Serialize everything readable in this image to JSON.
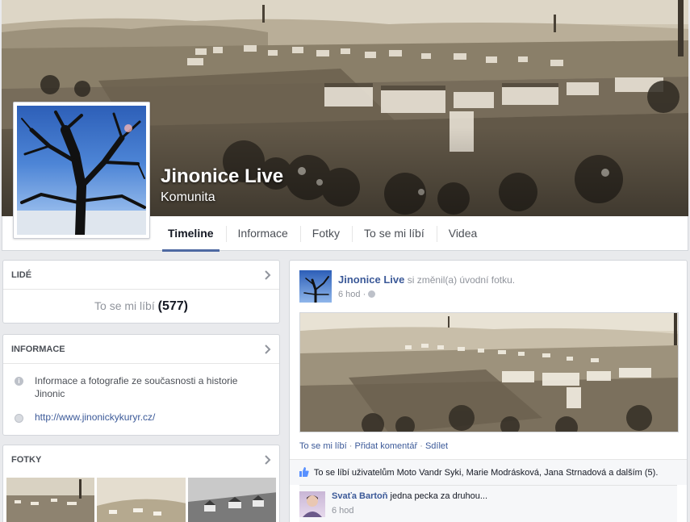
{
  "page": {
    "name": "Jinonice Live",
    "category": "Komunita"
  },
  "tabs": [
    {
      "label": "Timeline",
      "active": true
    },
    {
      "label": "Informace",
      "active": false
    },
    {
      "label": "Fotky",
      "active": false
    },
    {
      "label": "To se mi líbí",
      "active": false
    },
    {
      "label": "Videa",
      "active": false
    }
  ],
  "people": {
    "title": "LIDÉ",
    "likes_label": "To se mi líbí",
    "likes_count": "(577)"
  },
  "about": {
    "title": "INFORMACE",
    "description": "Informace a fotografie ze současnosti a historie Jinonic",
    "website": "http://www.jinonickykuryr.cz/"
  },
  "photos": {
    "title": "FOTKY"
  },
  "post": {
    "author": "Jinonice Live",
    "action": "si změnil(a) úvodní fotku.",
    "time": "6 hod",
    "actions": {
      "like": "To se mi líbí",
      "comment": "Přidat komentář",
      "share": "Sdílet"
    },
    "likes_text": "To se líbí uživatelům Moto Vandr Syki, Marie Modrásková, Jana Strnadová a dalším (5).",
    "comment": {
      "author": "Svaťa Bartoň",
      "text": "jedna pecka za druhou...",
      "time": "6 hod"
    }
  },
  "colors": {
    "link": "#3b5998",
    "background": "#e9eaed",
    "tab_active_underline": "#4e69a2"
  }
}
